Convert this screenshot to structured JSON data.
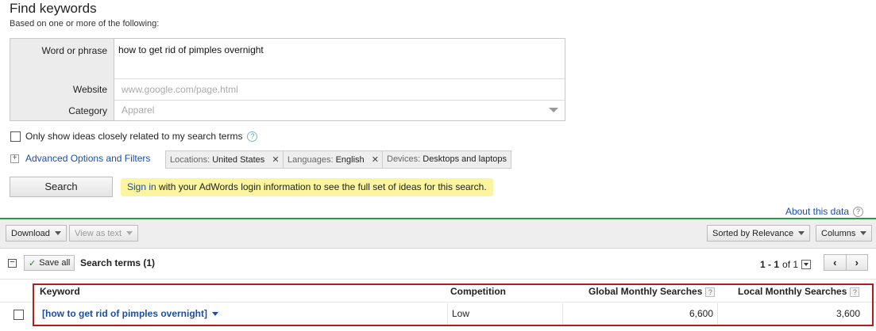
{
  "header": {
    "title": "Find keywords",
    "subtitle": "Based on one or more of the following:"
  },
  "form": {
    "word_label": "Word or phrase",
    "word_value": "how to get rid of pimples overnight",
    "website_label": "Website",
    "website_placeholder": "www.google.com/page.html",
    "category_label": "Category",
    "category_placeholder": "Apparel"
  },
  "options": {
    "only_show_label": "Only show ideas closely related to my search terms",
    "advanced_label": "Advanced Options and Filters",
    "chips": [
      {
        "prefix": "Locations:",
        "value": "United States"
      },
      {
        "prefix": "Languages:",
        "value": "English"
      },
      {
        "prefix": "Devices:",
        "value": "Desktops and laptops"
      }
    ]
  },
  "search": {
    "button_label": "Search",
    "notice_link": "Sign in",
    "notice_text": " with your AdWords login information to see the full set of ideas for this search."
  },
  "about_label": "About this data",
  "toolbar": {
    "download_label": "Download",
    "view_as_text_label": "View as text",
    "sort_label": "Sorted by Relevance",
    "columns_label": "Columns"
  },
  "results": {
    "save_all_label": "Save all",
    "section_title": "Search terms (1)",
    "pager_range": "1 - 1",
    "pager_of": "of 1",
    "prev_label": "‹",
    "next_label": "›",
    "columns": {
      "keyword": "Keyword",
      "competition": "Competition",
      "global": "Global Monthly Searches",
      "local": "Local Monthly Searches"
    },
    "rows": [
      {
        "keyword": "[how to get rid of pimples overnight]",
        "competition": "Low",
        "global": "6,600",
        "local": "3,600"
      }
    ]
  },
  "colors": {
    "link": "#1d4ea6",
    "notice_bg": "#fbf59f",
    "divider_green": "#2b9a45",
    "highlight_red": "#b11d1d"
  }
}
